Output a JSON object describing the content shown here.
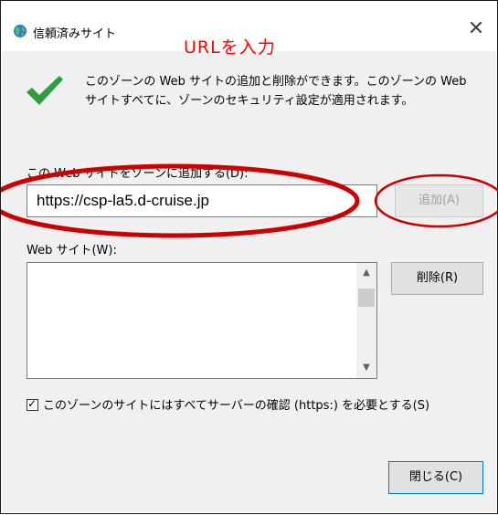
{
  "window": {
    "title": "信頼済みサイト",
    "close_glyph": "✕"
  },
  "annotation": {
    "instruction": "URLを入力",
    "color": "#ff0000"
  },
  "description": "このゾーンの Web サイトの追加と削除ができます。このゾーンの Web サイトすべてに、ゾーンのセキュリティ設定が適用されます。",
  "add_section": {
    "label": "この Web サイトをゾーンに追加する(D):",
    "input_value": "https://csp-la5.d-cruise.jp",
    "add_button": "追加(A)"
  },
  "list_section": {
    "label": "Web サイト(W):",
    "items": [],
    "remove_button": "削除(R)"
  },
  "https_checkbox": {
    "checked": true,
    "label": "このゾーンのサイトにはすべてサーバーの確認 (https:) を必要とする(S)"
  },
  "close_button": "閉じる(C)",
  "icons": {
    "title": "globe-icon",
    "info": "checkmark-icon"
  },
  "colors": {
    "check_green": "#2e9e3e",
    "accent": "#0078d7"
  }
}
